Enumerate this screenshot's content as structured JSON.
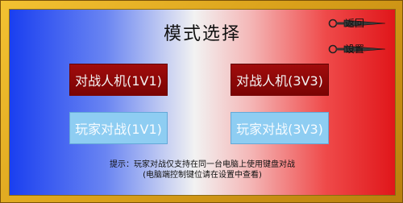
{
  "title": "模式选择",
  "top_buttons": {
    "back_label": "返回",
    "settings_label": "设置"
  },
  "modes": {
    "pve_1v1": "对战人机(1V1)",
    "pve_3v3": "对战人机(3V3)",
    "pvp_1v1": "玩家对战(1V1)",
    "pvp_3v3": "玩家对战(3V3)"
  },
  "hint": {
    "line1": "提示：玩家对战仅支持在同一台电脑上使用键盘对战",
    "line2": "(电脑端控制键位请在设置中查看)"
  },
  "colors": {
    "frame": "#e0a820",
    "pve_button": "#8f0808",
    "pvp_button": "#8ecdf2",
    "gradient_left": "#1a3ff0",
    "gradient_right": "#e0161a"
  },
  "icons": {
    "back": "kunai-icon",
    "settings": "kunai-icon"
  }
}
